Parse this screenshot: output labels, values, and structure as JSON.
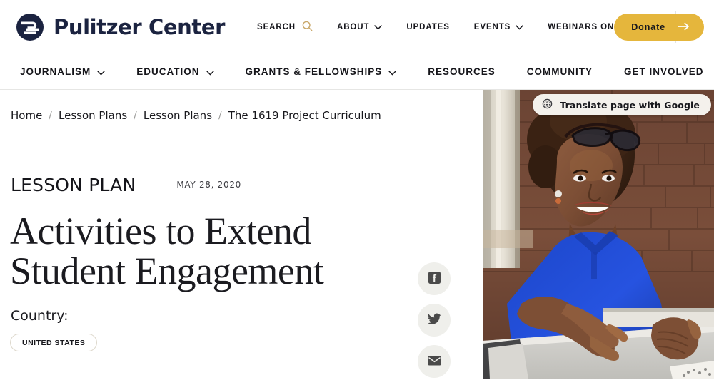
{
  "site": {
    "brand_name": "Pulitzer Center",
    "logo_icon": "pulitzer-circle-logo"
  },
  "header": {
    "utility_nav": [
      {
        "label": "Search",
        "icon": "search-icon",
        "has_caret": false
      },
      {
        "label": "About",
        "icon": "chevron-down-icon",
        "has_caret": true
      },
      {
        "label": "Updates",
        "icon": "",
        "has_caret": false
      },
      {
        "label": "Events",
        "icon": "chevron-down-icon",
        "has_caret": true
      },
      {
        "label": "Webinars On-Demand",
        "icon": "",
        "has_caret": false
      }
    ],
    "donate": {
      "label": "Donate",
      "icon": "arrow-right-icon",
      "background": "#E5B63C",
      "text_color": "#17171C"
    }
  },
  "main_nav": {
    "items": [
      {
        "label": "Journalism",
        "has_caret": true
      },
      {
        "label": "Education",
        "has_caret": true
      },
      {
        "label": "Grants & Fellowships",
        "has_caret": true
      },
      {
        "label": "Resources",
        "has_caret": false
      },
      {
        "label": "Community",
        "has_caret": false
      },
      {
        "label": "Get Involved",
        "has_caret": false
      }
    ]
  },
  "breadcrumb": {
    "separator": "/",
    "items": [
      {
        "label": "Home"
      },
      {
        "label": "Lesson Plans"
      },
      {
        "label": "Lesson Plans"
      },
      {
        "label": "The 1619 Project Curriculum"
      }
    ]
  },
  "article": {
    "kicker": "LESSON PLAN",
    "date": "MAY 28, 2020",
    "title_line_1": "Activities to Extend",
    "title_line_2": "Student Engagement",
    "country_label": "Country:",
    "tags": [
      {
        "label": "UNITED STATES"
      }
    ]
  },
  "share": {
    "buttons": [
      {
        "name": "facebook",
        "icon": "facebook-icon"
      },
      {
        "name": "twitter",
        "icon": "twitter-icon"
      },
      {
        "name": "email",
        "icon": "email-icon"
      }
    ]
  },
  "hero": {
    "alt": "Smiling student in a blue polo shirt with eyeglasses resting on her hair, seated at a desk in front of a brick wall",
    "translate_button": {
      "label": "Translate page with Google",
      "icon": "globe-icon"
    }
  },
  "colors": {
    "brand_navy": "#1B2340",
    "accent_gold": "#E5B63C",
    "search_icon": "#C9A86A",
    "tag_border": "#DDD8CC",
    "divider": "#D9D2C2",
    "share_bg": "#EFEFEB",
    "text": "#17171C"
  }
}
